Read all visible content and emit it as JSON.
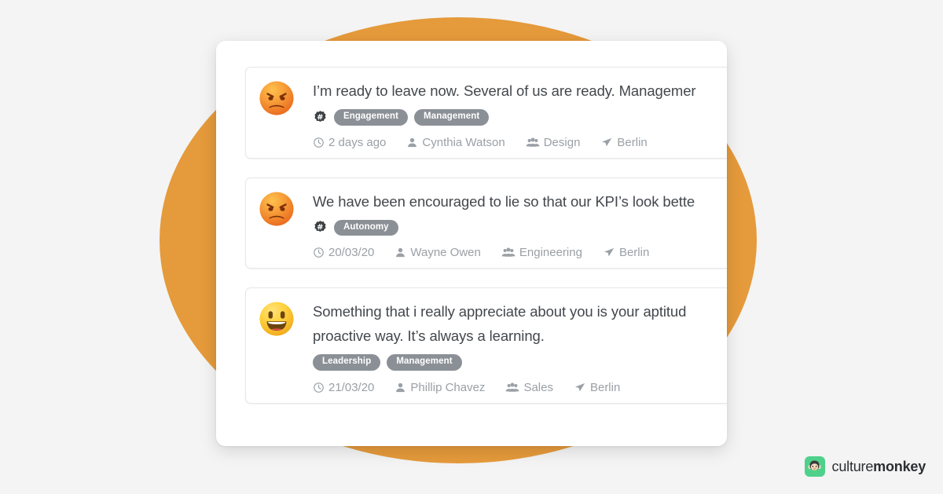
{
  "theme": {
    "page_bg": "#f4f4f4",
    "accent_circle": "#e59a3b",
    "panel_bg": "#ffffff",
    "tag_bg": "#8b9096",
    "text_primary": "#43474c",
    "text_meta": "#9aa0a6",
    "brand_green": "#4fd18b"
  },
  "feed": {
    "cards": [
      {
        "sentiment": "angry-face-emoji",
        "message": "I’m ready to leave now. Several of us are ready. Managemer",
        "has_hash_icon": true,
        "hash_icon": "hash-badge-icon",
        "tags": [
          "Engagement",
          "Management"
        ],
        "meta": {
          "time_icon": "clock-icon",
          "time": "2 days ago",
          "person_icon": "user-icon",
          "person": "Cynthia Watson",
          "team_icon": "users-group-icon",
          "team": "Design",
          "location_icon": "send-location-icon",
          "location": "Berlin"
        }
      },
      {
        "sentiment": "angry-face-emoji",
        "message": "We have been encouraged to lie so that our KPI’s look bette",
        "has_hash_icon": true,
        "hash_icon": "hash-badge-icon",
        "tags": [
          "Autonomy"
        ],
        "meta": {
          "time_icon": "clock-icon",
          "time": "20/03/20",
          "person_icon": "user-icon",
          "person": "Wayne Owen",
          "team_icon": "users-group-icon",
          "team": "Engineering",
          "location_icon": "send-location-icon",
          "location": "Berlin"
        }
      },
      {
        "sentiment": "grinning-face-emoji",
        "message": "Something that i really appreciate about you is your aptitud\nproactive way. It’s always a learning.",
        "has_hash_icon": false,
        "hash_icon": "",
        "tags": [
          "Leadership",
          "Management"
        ],
        "meta": {
          "time_icon": "clock-icon",
          "time": "21/03/20",
          "person_icon": "user-icon",
          "person": "Phillip Chavez",
          "team_icon": "users-group-icon",
          "team": "Sales",
          "location_icon": "send-location-icon",
          "location": "Berlin"
        }
      }
    ]
  },
  "brand": {
    "mark_icon": "monkey-face-icon",
    "name_light": "culture",
    "name_bold": "monkey"
  }
}
